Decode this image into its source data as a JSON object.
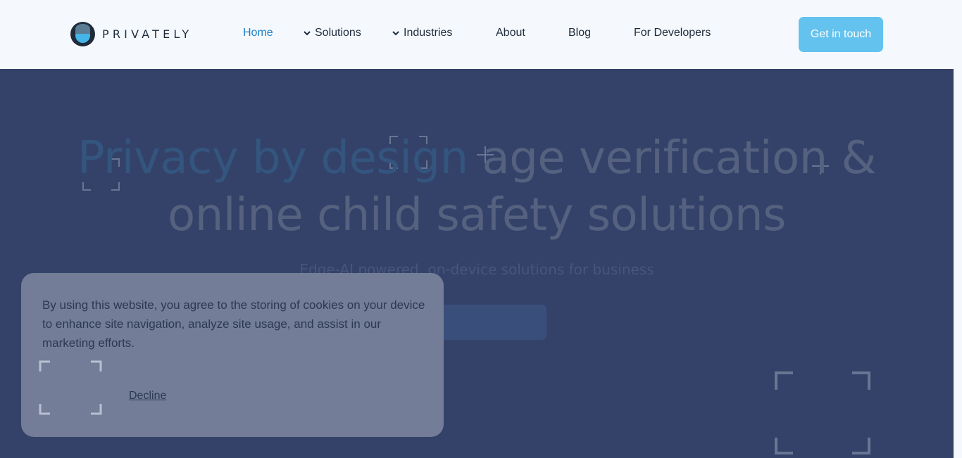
{
  "brand": {
    "name": "PRIVATELY",
    "logo_icon": "privately-logo-icon"
  },
  "nav": {
    "items": [
      {
        "label": "Home",
        "active": true,
        "dropdown": false
      },
      {
        "label": "Solutions",
        "active": false,
        "dropdown": true
      },
      {
        "label": "Industries",
        "active": false,
        "dropdown": true
      },
      {
        "label": "About",
        "active": false,
        "dropdown": false
      },
      {
        "label": "Blog",
        "active": false,
        "dropdown": false
      },
      {
        "label": "For Developers",
        "active": false,
        "dropdown": false
      }
    ],
    "cta_label": "Get in touch"
  },
  "hero": {
    "headline_accent": "Privacy by design",
    "headline_rest_line1": " age verification &",
    "headline_line2_accent": "online child",
    "headline_line2_rest": " safety solutions",
    "subline": "Edge-AI powered, on-device solutions for business",
    "button_label": ""
  },
  "cookie": {
    "text": "By using this website, you agree to the storing of cookies on your device to enhance site navigation, analyze site usage, and assist in our marketing efforts.",
    "decline_label": "Decline"
  },
  "colors": {
    "accent": "#1b7fc4",
    "cta": "#63c2ee",
    "hero_bg": "#34426a",
    "header_bg": "#f5f9fd",
    "cookie_bg": "#737d97"
  }
}
